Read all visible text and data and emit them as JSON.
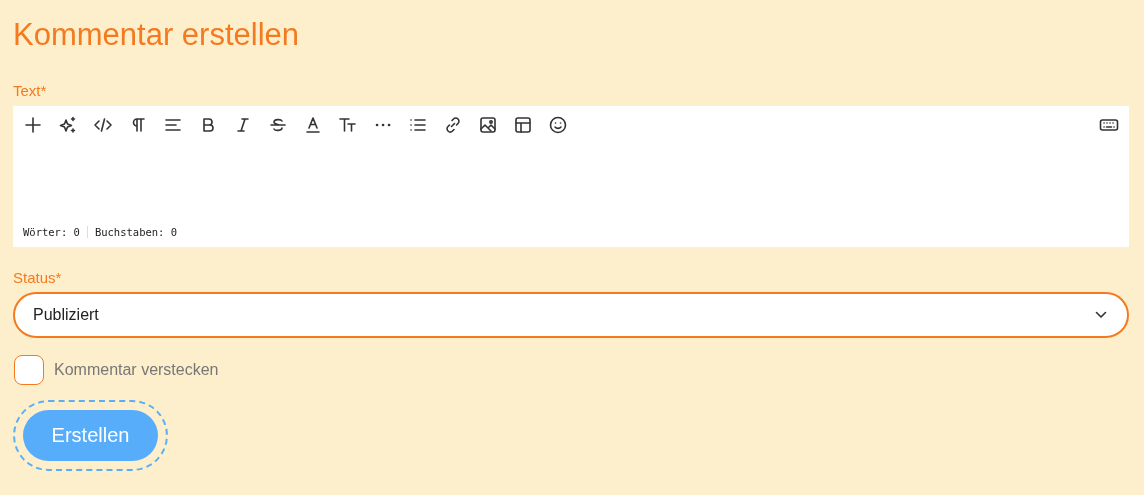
{
  "title": "Kommentar erstellen",
  "text_field": {
    "label": "Text*",
    "word_count": "Wörter: 0",
    "char_count": "Buchstaben: 0"
  },
  "status_field": {
    "label": "Status*",
    "value": "Publiziert"
  },
  "hide_checkbox": {
    "label": "Kommentar verstecken",
    "checked": false
  },
  "submit_button": {
    "label": "Erstellen",
    "focused": true
  }
}
